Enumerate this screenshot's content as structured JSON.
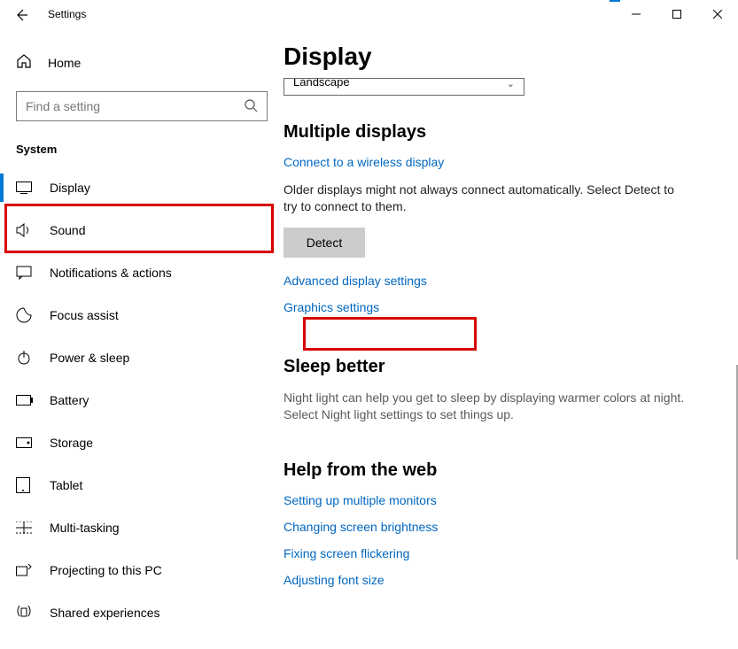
{
  "window": {
    "title": "Settings"
  },
  "sidebar": {
    "home": "Home",
    "search_placeholder": "Find a setting",
    "section": "System",
    "items": [
      {
        "icon": "display-icon",
        "label": "Display",
        "active": true
      },
      {
        "icon": "sound-icon",
        "label": "Sound"
      },
      {
        "icon": "notifications-icon",
        "label": "Notifications & actions"
      },
      {
        "icon": "focus-assist-icon",
        "label": "Focus assist"
      },
      {
        "icon": "power-sleep-icon",
        "label": "Power & sleep"
      },
      {
        "icon": "battery-icon",
        "label": "Battery"
      },
      {
        "icon": "storage-icon",
        "label": "Storage"
      },
      {
        "icon": "tablet-icon",
        "label": "Tablet"
      },
      {
        "icon": "multitasking-icon",
        "label": "Multi-tasking"
      },
      {
        "icon": "projecting-icon",
        "label": "Projecting to this PC"
      },
      {
        "icon": "shared-icon",
        "label": "Shared experiences"
      }
    ]
  },
  "main": {
    "title": "Display",
    "orientation_value": "Landscape",
    "multiple_displays": {
      "heading": "Multiple displays",
      "wireless_link": "Connect to a wireless display",
      "older_text": "Older displays might not always connect automatically. Select Detect to try to connect to them.",
      "detect_btn": "Detect",
      "advanced_link": "Advanced display settings",
      "graphics_link": "Graphics settings"
    },
    "sleep_better": {
      "heading": "Sleep better",
      "body": "Night light can help you get to sleep by displaying warmer colors at night. Select Night light settings to set things up."
    },
    "help": {
      "heading": "Help from the web",
      "links": [
        "Setting up multiple monitors",
        "Changing screen brightness",
        "Fixing screen flickering",
        "Adjusting font size"
      ]
    }
  }
}
